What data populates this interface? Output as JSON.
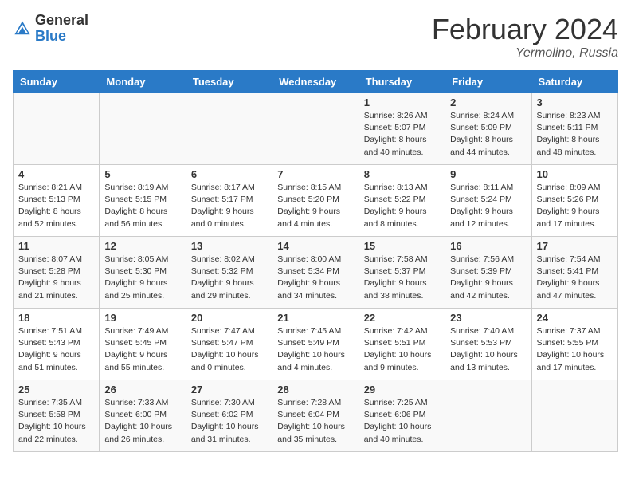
{
  "logo": {
    "general": "General",
    "blue": "Blue"
  },
  "title": "February 2024",
  "location": "Yermolino, Russia",
  "days_of_week": [
    "Sunday",
    "Monday",
    "Tuesday",
    "Wednesday",
    "Thursday",
    "Friday",
    "Saturday"
  ],
  "weeks": [
    [
      {
        "day": "",
        "info": ""
      },
      {
        "day": "",
        "info": ""
      },
      {
        "day": "",
        "info": ""
      },
      {
        "day": "",
        "info": ""
      },
      {
        "day": "1",
        "info": "Sunrise: 8:26 AM\nSunset: 5:07 PM\nDaylight: 8 hours\nand 40 minutes."
      },
      {
        "day": "2",
        "info": "Sunrise: 8:24 AM\nSunset: 5:09 PM\nDaylight: 8 hours\nand 44 minutes."
      },
      {
        "day": "3",
        "info": "Sunrise: 8:23 AM\nSunset: 5:11 PM\nDaylight: 8 hours\nand 48 minutes."
      }
    ],
    [
      {
        "day": "4",
        "info": "Sunrise: 8:21 AM\nSunset: 5:13 PM\nDaylight: 8 hours\nand 52 minutes."
      },
      {
        "day": "5",
        "info": "Sunrise: 8:19 AM\nSunset: 5:15 PM\nDaylight: 8 hours\nand 56 minutes."
      },
      {
        "day": "6",
        "info": "Sunrise: 8:17 AM\nSunset: 5:17 PM\nDaylight: 9 hours\nand 0 minutes."
      },
      {
        "day": "7",
        "info": "Sunrise: 8:15 AM\nSunset: 5:20 PM\nDaylight: 9 hours\nand 4 minutes."
      },
      {
        "day": "8",
        "info": "Sunrise: 8:13 AM\nSunset: 5:22 PM\nDaylight: 9 hours\nand 8 minutes."
      },
      {
        "day": "9",
        "info": "Sunrise: 8:11 AM\nSunset: 5:24 PM\nDaylight: 9 hours\nand 12 minutes."
      },
      {
        "day": "10",
        "info": "Sunrise: 8:09 AM\nSunset: 5:26 PM\nDaylight: 9 hours\nand 17 minutes."
      }
    ],
    [
      {
        "day": "11",
        "info": "Sunrise: 8:07 AM\nSunset: 5:28 PM\nDaylight: 9 hours\nand 21 minutes."
      },
      {
        "day": "12",
        "info": "Sunrise: 8:05 AM\nSunset: 5:30 PM\nDaylight: 9 hours\nand 25 minutes."
      },
      {
        "day": "13",
        "info": "Sunrise: 8:02 AM\nSunset: 5:32 PM\nDaylight: 9 hours\nand 29 minutes."
      },
      {
        "day": "14",
        "info": "Sunrise: 8:00 AM\nSunset: 5:34 PM\nDaylight: 9 hours\nand 34 minutes."
      },
      {
        "day": "15",
        "info": "Sunrise: 7:58 AM\nSunset: 5:37 PM\nDaylight: 9 hours\nand 38 minutes."
      },
      {
        "day": "16",
        "info": "Sunrise: 7:56 AM\nSunset: 5:39 PM\nDaylight: 9 hours\nand 42 minutes."
      },
      {
        "day": "17",
        "info": "Sunrise: 7:54 AM\nSunset: 5:41 PM\nDaylight: 9 hours\nand 47 minutes."
      }
    ],
    [
      {
        "day": "18",
        "info": "Sunrise: 7:51 AM\nSunset: 5:43 PM\nDaylight: 9 hours\nand 51 minutes."
      },
      {
        "day": "19",
        "info": "Sunrise: 7:49 AM\nSunset: 5:45 PM\nDaylight: 9 hours\nand 55 minutes."
      },
      {
        "day": "20",
        "info": "Sunrise: 7:47 AM\nSunset: 5:47 PM\nDaylight: 10 hours\nand 0 minutes."
      },
      {
        "day": "21",
        "info": "Sunrise: 7:45 AM\nSunset: 5:49 PM\nDaylight: 10 hours\nand 4 minutes."
      },
      {
        "day": "22",
        "info": "Sunrise: 7:42 AM\nSunset: 5:51 PM\nDaylight: 10 hours\nand 9 minutes."
      },
      {
        "day": "23",
        "info": "Sunrise: 7:40 AM\nSunset: 5:53 PM\nDaylight: 10 hours\nand 13 minutes."
      },
      {
        "day": "24",
        "info": "Sunrise: 7:37 AM\nSunset: 5:55 PM\nDaylight: 10 hours\nand 17 minutes."
      }
    ],
    [
      {
        "day": "25",
        "info": "Sunrise: 7:35 AM\nSunset: 5:58 PM\nDaylight: 10 hours\nand 22 minutes."
      },
      {
        "day": "26",
        "info": "Sunrise: 7:33 AM\nSunset: 6:00 PM\nDaylight: 10 hours\nand 26 minutes."
      },
      {
        "day": "27",
        "info": "Sunrise: 7:30 AM\nSunset: 6:02 PM\nDaylight: 10 hours\nand 31 minutes."
      },
      {
        "day": "28",
        "info": "Sunrise: 7:28 AM\nSunset: 6:04 PM\nDaylight: 10 hours\nand 35 minutes."
      },
      {
        "day": "29",
        "info": "Sunrise: 7:25 AM\nSunset: 6:06 PM\nDaylight: 10 hours\nand 40 minutes."
      },
      {
        "day": "",
        "info": ""
      },
      {
        "day": "",
        "info": ""
      }
    ]
  ]
}
